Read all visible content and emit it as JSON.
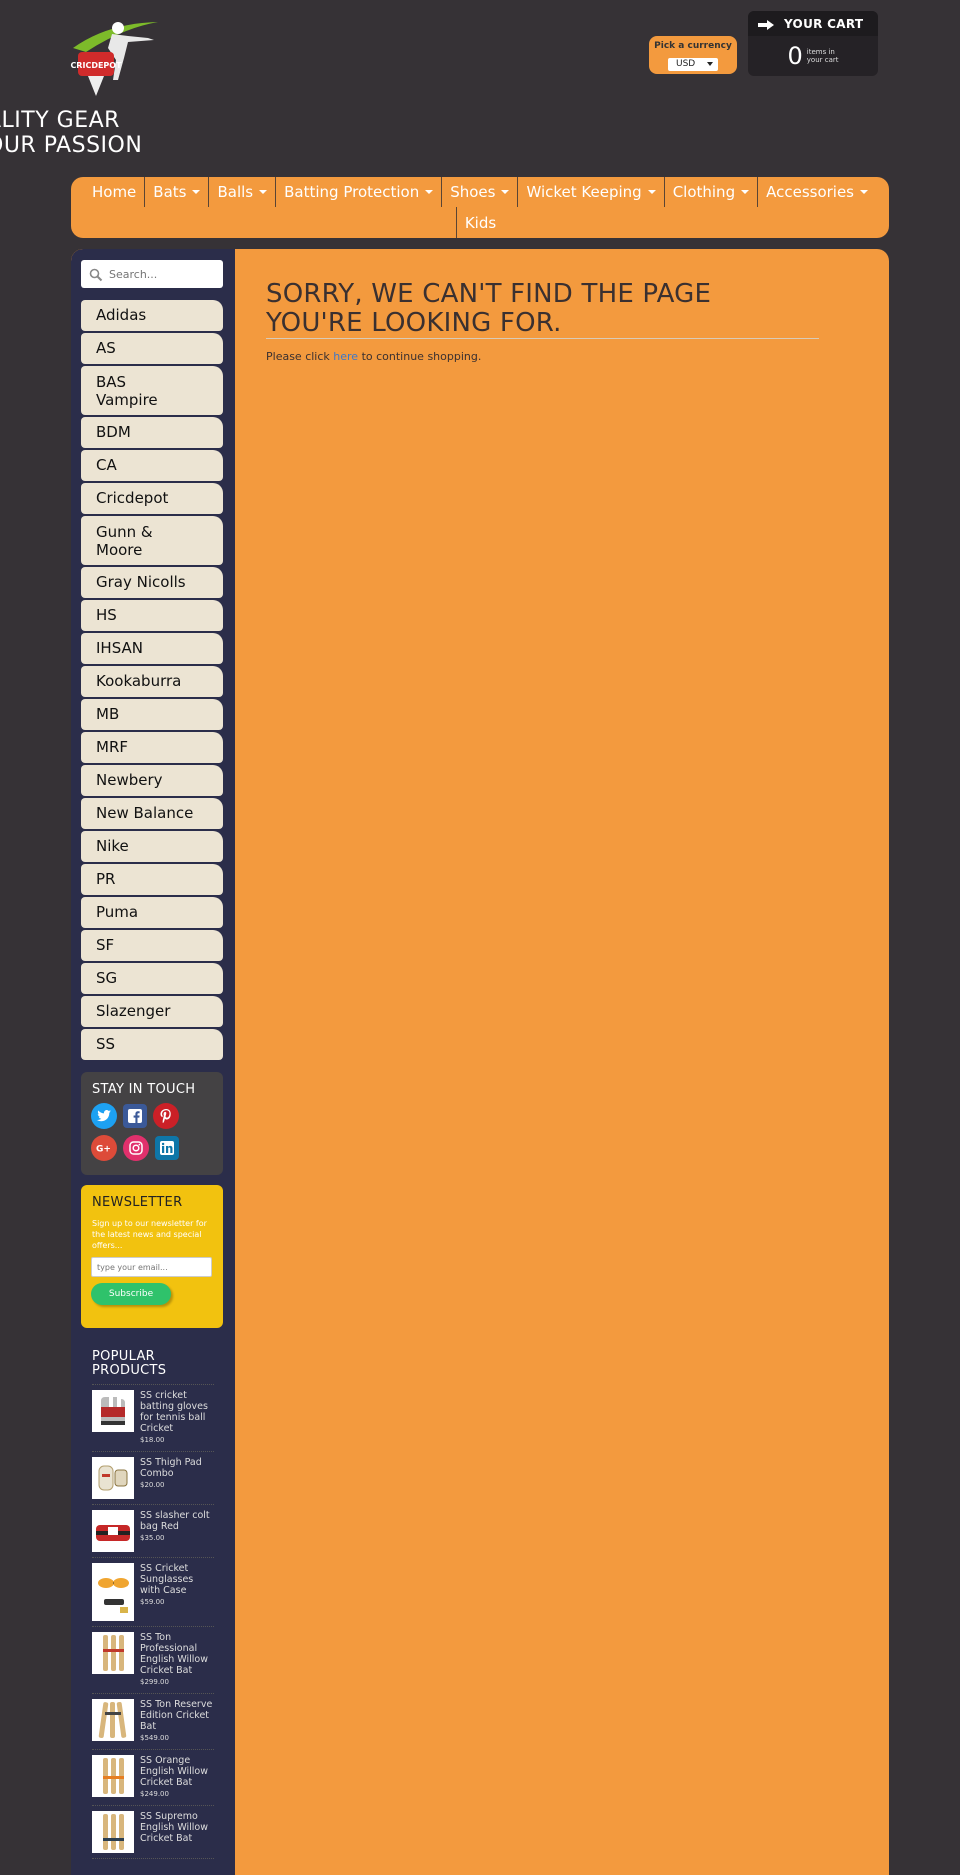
{
  "header": {
    "logo_text": "CRICDEPOT",
    "tagline_line1": "ALITY GEAR",
    "tagline_line2": "OUR PASSION"
  },
  "currency": {
    "label": "Pick a currency",
    "selected": "USD"
  },
  "cart": {
    "title": "YOUR CART",
    "count": "0",
    "text_line1": "items in",
    "text_line2": "your cart"
  },
  "nav": {
    "items": [
      {
        "label": "Home",
        "dropdown": false
      },
      {
        "label": "Bats",
        "dropdown": true
      },
      {
        "label": "Balls",
        "dropdown": true
      },
      {
        "label": "Batting Protection",
        "dropdown": true
      },
      {
        "label": "Shoes",
        "dropdown": true
      },
      {
        "label": "Wicket Keeping",
        "dropdown": true
      },
      {
        "label": "Clothing",
        "dropdown": true
      },
      {
        "label": "Accessories",
        "dropdown": true
      },
      {
        "label": "Kids",
        "dropdown": false
      }
    ]
  },
  "sidebar": {
    "search_placeholder": "Search...",
    "brands": [
      {
        "label": "Adidas"
      },
      {
        "label": "AS"
      },
      {
        "label": "BAS Vampire"
      },
      {
        "label": "BDM"
      },
      {
        "label": "CA"
      },
      {
        "label": "Cricdepot"
      },
      {
        "label": "Gunn & Moore"
      },
      {
        "label": "Gray Nicolls"
      },
      {
        "label": "HS"
      },
      {
        "label": "IHSAN"
      },
      {
        "label": "Kookaburra"
      },
      {
        "label": "MB"
      },
      {
        "label": "MRF"
      },
      {
        "label": "Newbery"
      },
      {
        "label": "New Balance"
      },
      {
        "label": "Nike"
      },
      {
        "label": "PR"
      },
      {
        "label": "Puma"
      },
      {
        "label": "SF"
      },
      {
        "label": "SG"
      },
      {
        "label": "Slazenger"
      },
      {
        "label": "SS"
      }
    ],
    "stay_in_touch": {
      "title": "STAY IN TOUCH",
      "networks": [
        {
          "name": "twitter-icon",
          "color": "#1da1f2",
          "glyph": "t"
        },
        {
          "name": "facebook-icon",
          "color": "#3b5998",
          "glyph": "f"
        },
        {
          "name": "pinterest-icon",
          "color": "#cb2027",
          "glyph": "P"
        },
        {
          "name": "google-plus-icon",
          "color": "#dd4b39",
          "glyph": "G+"
        },
        {
          "name": "instagram-icon",
          "color": "#e1306c",
          "glyph": "◎"
        },
        {
          "name": "linkedin-icon",
          "color": "#0e76a8",
          "glyph": "in"
        }
      ]
    },
    "newsletter": {
      "title": "NEWSLETTER",
      "text": "Sign up to our newsletter for the latest news and special offers...",
      "placeholder": "type your email...",
      "button": "Subscribe"
    },
    "popular": {
      "title_line1": "POPULAR",
      "title_line2": "PRODUCTS",
      "products": [
        {
          "name": "SS cricket batting gloves for tennis ball Cricket",
          "price": "$18.00"
        },
        {
          "name": "SS Thigh Pad Combo",
          "price": "$20.00"
        },
        {
          "name": "SS slasher colt bag Red",
          "price": "$35.00"
        },
        {
          "name": "SS Cricket Sunglasses with Case",
          "price": "$59.00"
        },
        {
          "name": "SS Ton Professional English Willow Cricket Bat",
          "price": "$299.00"
        },
        {
          "name": "SS Ton Reserve Edition Cricket Bat",
          "price": "$549.00"
        },
        {
          "name": "SS Orange English Willow Cricket Bat",
          "price": "$249.00"
        },
        {
          "name": "SS Supremo English Willow Cricket Bat",
          "price": ""
        }
      ]
    }
  },
  "main": {
    "heading_line1": "SORRY, WE CAN'T FIND THE PAGE",
    "heading_line2": "YOU'RE LOOKING FOR.",
    "text_before": "Please click ",
    "link_text": "here",
    "text_after": " to continue shopping."
  },
  "colors": {
    "background": "#363236",
    "accent": "#f39a3e",
    "sidebar": "#2b2d4a",
    "brand_tab": "#ece4d3",
    "newsletter": "#f2c20f",
    "subscribe": "#2fc26b"
  }
}
